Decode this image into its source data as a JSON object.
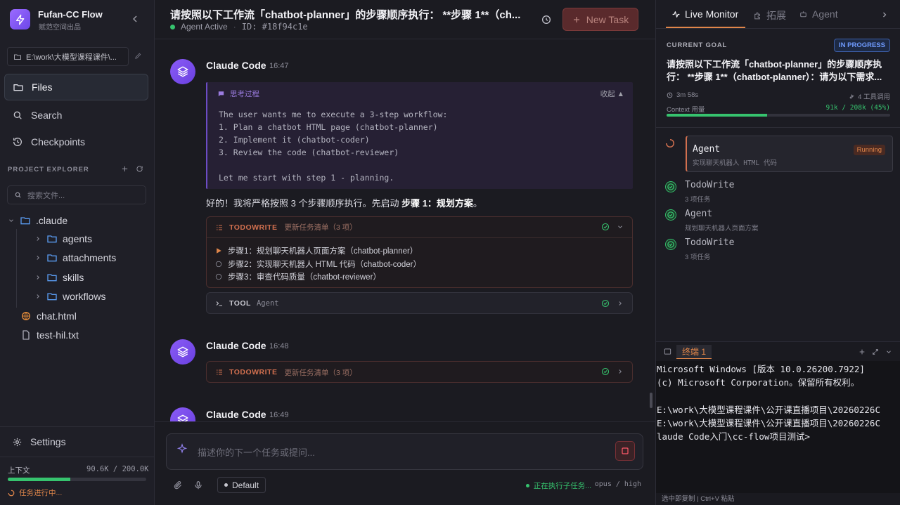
{
  "app": {
    "name": "Fufan-CC Flow",
    "subtitle": "赋范空间出品"
  },
  "sidebar": {
    "path": "E:\\work\\大模型课程课件\\...",
    "nav": [
      {
        "label": "Files",
        "icon": "folder-icon"
      },
      {
        "label": "Search",
        "icon": "search-icon"
      },
      {
        "label": "Checkpoints",
        "icon": "history-icon"
      }
    ],
    "project_explorer_title": "PROJECT EXPLORER",
    "file_search_placeholder": "搜索文件...",
    "tree": [
      {
        "name": ".claude",
        "type": "folder",
        "expanded": true
      },
      {
        "name": "agents",
        "type": "folder"
      },
      {
        "name": "attachments",
        "type": "folder"
      },
      {
        "name": "skills",
        "type": "folder"
      },
      {
        "name": "workflows",
        "type": "folder"
      },
      {
        "name": "chat.html",
        "type": "html"
      },
      {
        "name": "test-hil.txt",
        "type": "file"
      }
    ],
    "settings_label": "Settings",
    "context_label": "上下文",
    "context_value": "90.6K / 200.0K",
    "context_fraction": 0.45,
    "task_progress": "任务进行中..."
  },
  "topbar": {
    "title": "请按照以下工作流「chatbot-planner」的步骤顺序执行： **步骤 1**（ch...",
    "status": "Agent Active",
    "id": "ID: #18f94c1e",
    "new_task": "New Task"
  },
  "chat": {
    "messages": [
      {
        "author": "Claude Code",
        "time": "16:47",
        "thinking_label": "思考过程",
        "collapse_label": "收起",
        "thinking": "The user wants me to execute a 3-step workflow:\n1. Plan a chatbot HTML page (chatbot-planner)\n2. Implement it (chatbot-coder)\n3. Review the code (chatbot-reviewer)\n\nLet me start with step 1 - planning.",
        "reply_prefix": "好的！我将严格按照 3 个步骤顺序执行。先启动 ",
        "reply_bold": "步骤 1：规划方案",
        "reply_suffix": "。",
        "todo": {
          "kind": "TODOWRITE",
          "desc": "更新任务清单（3 项）",
          "items": [
            {
              "text": "步骤1：规划聊天机器人页面方案（chatbot-planner）",
              "state": "active"
            },
            {
              "text": "步骤2：实现聊天机器人 HTML 代码（chatbot-coder）",
              "state": "pending"
            },
            {
              "text": "步骤3：审查代码质量（chatbot-reviewer）",
              "state": "pending"
            }
          ]
        },
        "tool": {
          "kind": "TOOL",
          "name": "Agent"
        }
      },
      {
        "author": "Claude Code",
        "time": "16:48",
        "todo": {
          "kind": "TODOWRITE",
          "desc": "更新任务清单（3 项）"
        }
      },
      {
        "author": "Claude Code",
        "time": "16:49"
      }
    ]
  },
  "composer": {
    "placeholder": "描述你的下一个任务或提问...",
    "mode": "Default",
    "exec_status": "正在执行子任务...",
    "model": "opus / high"
  },
  "right": {
    "tabs": [
      {
        "label": "Live Monitor",
        "active": true
      },
      {
        "label": "拓展"
      },
      {
        "label": "Agent"
      }
    ],
    "goal_label": "CURRENT GOAL",
    "goal_status": "IN PROGRESS",
    "goal_text": "请按照以下工作流「chatbot-planner」的步骤顺序执行： **步骤 1**（chatbot-planner）：请为以下需求...",
    "elapsed": "3m 58s",
    "tools_used": "4 工具调用",
    "context_label": "Context 用量",
    "context_value": "91k / 208k (45%)",
    "context_fraction": 0.45,
    "steps": [
      {
        "title": "Agent",
        "sub": "实现聊天机器人 HTML 代码",
        "status": "Running"
      },
      {
        "title": "TodoWrite",
        "sub": "3 项任务",
        "status": "done"
      },
      {
        "title": "Agent",
        "sub": "规划聊天机器人页面方案",
        "status": "done"
      },
      {
        "title": "TodoWrite",
        "sub": "3 项任务",
        "status": "done"
      }
    ],
    "terminal_tab": "终端 1",
    "terminal_lines": [
      "Microsoft Windows [版本 10.0.26200.7922]",
      "(c) Microsoft Corporation。保留所有权利。",
      "",
      "E:\\work\\大模型课程课件\\公开课直播项目\\20260226C",
      "E:\\work\\大模型课程课件\\公开课直播项目\\20260226C",
      "laude Code入门\\cc-flow项目测试>"
    ],
    "terminal_footer": "选中即复制 | Ctrl+V 粘贴"
  },
  "colors": {
    "accent": "#7c4ff0",
    "success": "#36c36e",
    "warning": "#e0864a",
    "danger": "#d2704f"
  }
}
